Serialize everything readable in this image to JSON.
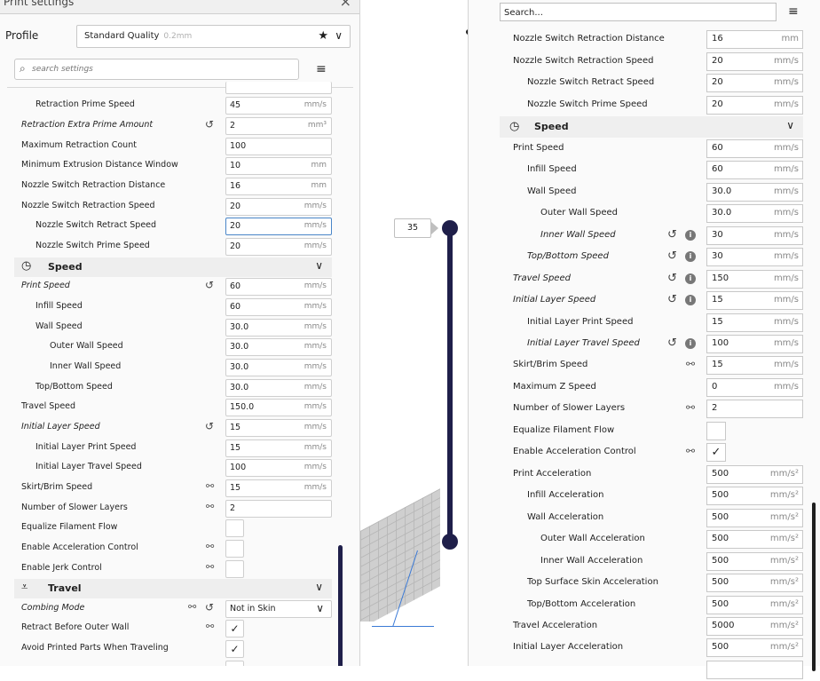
{
  "left_panel": {
    "title": "Print settings",
    "close_glyph": "×",
    "profile_label": "Profile",
    "profile_value": "Standard Quality",
    "profile_layer": "0.2mm",
    "star_glyph": "★",
    "chevron_glyph": "∨",
    "search_placeholder": "search settings",
    "search_icon_glyph": "⌕",
    "menu_glyph": "≡",
    "rows": [
      {
        "label": "Retraction Prime Speed",
        "value": "45",
        "unit": "mm/s"
      },
      {
        "label": "Retraction Extra Prime Amount",
        "value": "2",
        "unit": "mm³"
      },
      {
        "label": "Maximum Retraction Count",
        "value": "100",
        "unit": ""
      },
      {
        "label": "Minimum Extrusion Distance Window",
        "value": "10",
        "unit": "mm"
      },
      {
        "label": "Nozzle Switch Retraction Distance",
        "value": "16",
        "unit": "mm"
      },
      {
        "label": "Nozzle Switch Retraction Speed",
        "value": "20",
        "unit": "mm/s"
      },
      {
        "label": "Nozzle Switch Retract Speed",
        "value": "20",
        "unit": "mm/s"
      },
      {
        "label": "Nozzle Switch Prime Speed",
        "value": "20",
        "unit": "mm/s"
      },
      {
        "label": "Print Speed",
        "value": "60",
        "unit": "mm/s"
      },
      {
        "label": "Infill Speed",
        "value": "60",
        "unit": "mm/s"
      },
      {
        "label": "Wall Speed",
        "value": "30.0",
        "unit": "mm/s"
      },
      {
        "label": "Outer Wall Speed",
        "value": "30.0",
        "unit": "mm/s"
      },
      {
        "label": "Inner Wall Speed",
        "value": "30.0",
        "unit": "mm/s"
      },
      {
        "label": "Top/Bottom Speed",
        "value": "30.0",
        "unit": "mm/s"
      },
      {
        "label": "Travel Speed",
        "value": "150.0",
        "unit": "mm/s"
      },
      {
        "label": "Initial Layer Speed",
        "value": "15",
        "unit": "mm/s"
      },
      {
        "label": "Initial Layer Print Speed",
        "value": "15",
        "unit": "mm/s"
      },
      {
        "label": "Initial Layer Travel Speed",
        "value": "100",
        "unit": "mm/s"
      },
      {
        "label": "Skirt/Brim Speed",
        "value": "15",
        "unit": "mm/s"
      },
      {
        "label": "Number of Slower Layers",
        "value": "2",
        "unit": ""
      },
      {
        "label": "Equalize Filament Flow"
      },
      {
        "label": "Enable Acceleration Control"
      },
      {
        "label": "Enable Jerk Control"
      },
      {
        "label": "Combing Mode",
        "value": "Not in Skin"
      },
      {
        "label": "Retract Before Outer Wall",
        "check": "✓"
      },
      {
        "label": "Avoid Printed Parts When Traveling",
        "check": "✓"
      }
    ],
    "category_speed": "Speed",
    "category_travel": "Travel",
    "reset_glyph": "↺",
    "link_glyph": "⚯"
  },
  "viewport": {
    "layer_number": "35"
  },
  "right_panel": {
    "search_value": "Search...",
    "menu_glyph": "≡",
    "category_speed": "Speed",
    "check_glyph": "✓",
    "rows": [
      {
        "label": "Nozzle Switch Retraction Distance",
        "value": "16",
        "unit": "mm"
      },
      {
        "label": "Nozzle Switch Retraction Speed",
        "value": "20",
        "unit": "mm/s"
      },
      {
        "label": "Nozzle Switch Retract Speed",
        "value": "20",
        "unit": "mm/s"
      },
      {
        "label": "Nozzle Switch Prime Speed",
        "value": "20",
        "unit": "mm/s"
      },
      {
        "label": "Print Speed",
        "value": "60",
        "unit": "mm/s"
      },
      {
        "label": "Infill Speed",
        "value": "60",
        "unit": "mm/s"
      },
      {
        "label": "Wall Speed",
        "value": "30.0",
        "unit": "mm/s"
      },
      {
        "label": "Outer Wall Speed",
        "value": "30.0",
        "unit": "mm/s"
      },
      {
        "label": "Inner Wall Speed",
        "value": "30",
        "unit": "mm/s"
      },
      {
        "label": "Top/Bottom Speed",
        "value": "30",
        "unit": "mm/s"
      },
      {
        "label": "Travel Speed",
        "value": "150",
        "unit": "mm/s"
      },
      {
        "label": "Initial Layer Speed",
        "value": "15",
        "unit": "mm/s"
      },
      {
        "label": "Initial Layer Print Speed",
        "value": "15",
        "unit": "mm/s"
      },
      {
        "label": "Initial Layer Travel Speed",
        "value": "100",
        "unit": "mm/s"
      },
      {
        "label": "Skirt/Brim Speed",
        "value": "15",
        "unit": "mm/s"
      },
      {
        "label": "Maximum Z Speed",
        "value": "0",
        "unit": "mm/s"
      },
      {
        "label": "Number of Slower Layers",
        "value": "2",
        "unit": ""
      },
      {
        "label": "Equalize Filament Flow"
      },
      {
        "label": "Enable Acceleration Control"
      },
      {
        "label": "Print Acceleration",
        "value": "500",
        "unit": "mm/s²"
      },
      {
        "label": "Infill Acceleration",
        "value": "500",
        "unit": "mm/s²"
      },
      {
        "label": "Wall Acceleration",
        "value": "500",
        "unit": "mm/s²"
      },
      {
        "label": "Outer Wall Acceleration",
        "value": "500",
        "unit": "mm/s²"
      },
      {
        "label": "Inner Wall Acceleration",
        "value": "500",
        "unit": "mm/s²"
      },
      {
        "label": "Top Surface Skin Acceleration",
        "value": "500",
        "unit": "mm/s²"
      },
      {
        "label": "Top/Bottom Acceleration",
        "value": "500",
        "unit": "mm/s²"
      },
      {
        "label": "Travel Acceleration",
        "value": "5000",
        "unit": "mm/s²"
      },
      {
        "label": "Initial Layer Acceleration",
        "value": "500",
        "unit": "mm/s²"
      }
    ]
  }
}
